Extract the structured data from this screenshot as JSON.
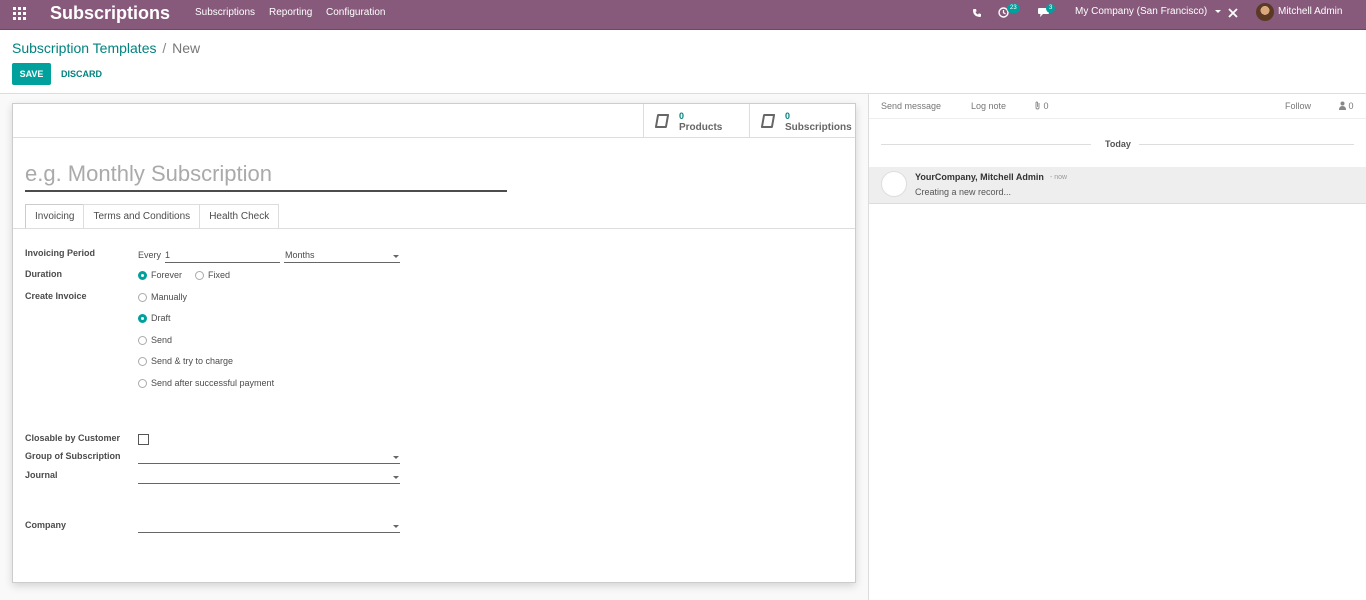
{
  "navbar": {
    "brand": "Subscriptions",
    "menu": [
      "Subscriptions",
      "Reporting",
      "Configuration"
    ],
    "activity_count": "23",
    "message_count": "3",
    "company": "My Company (San Francisco)",
    "user": "Mitchell Admin",
    "color": "#875a7b"
  },
  "breadcrumb": {
    "parent": "Subscription Templates",
    "separator": "/",
    "current": "New"
  },
  "actions": {
    "save": "SAVE",
    "discard": "DISCARD",
    "accent": "#00a09d"
  },
  "stat_buttons": [
    {
      "count": "0",
      "label": "Products",
      "icon": "book-icon"
    },
    {
      "count": "0",
      "label": "Subscriptions",
      "icon": "book-icon"
    }
  ],
  "form": {
    "name_placeholder": "e.g. Monthly Subscription",
    "tabs": [
      "Invoicing",
      "Terms and Conditions",
      "Health Check"
    ],
    "invoicing_period": {
      "label": "Invoicing Period",
      "prefix": "Every",
      "value": "1",
      "unit": "Months"
    },
    "duration": {
      "label": "Duration",
      "options": [
        "Forever",
        "Fixed"
      ],
      "selected": "Forever"
    },
    "create_invoice": {
      "label": "Create Invoice",
      "options": [
        "Manually",
        "Draft",
        "Send",
        "Send & try to charge",
        "Send after successful payment"
      ],
      "selected": "Draft"
    },
    "closable_label": "Closable by Customer",
    "closable_checked": false,
    "group_label": "Group of Subscription",
    "journal_label": "Journal",
    "company_label": "Company"
  },
  "chatter": {
    "send_message": "Send message",
    "log_note": "Log note",
    "attachments": "0",
    "follow": "Follow",
    "followers": "0",
    "today": "Today",
    "messages": [
      {
        "author": "YourCompany, Mitchell Admin",
        "time": "- now",
        "body": "Creating a new record..."
      }
    ]
  }
}
